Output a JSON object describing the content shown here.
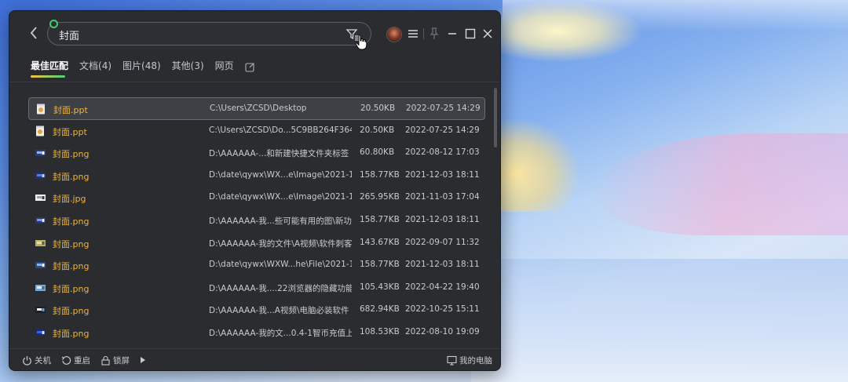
{
  "search": {
    "query": "封面"
  },
  "tabs": [
    {
      "label": "最佳匹配"
    },
    {
      "label": "文档(4)"
    },
    {
      "label": "图片(48)"
    },
    {
      "label": "其他(3)"
    },
    {
      "label": "网页"
    }
  ],
  "results": [
    {
      "icon": "ppt-file-icon",
      "name": "封面.ppt",
      "path": "C:\\Users\\ZCSD\\Desktop",
      "size": "20.50KB",
      "date": "2022-07-25 14:29",
      "selected": true
    },
    {
      "icon": "ppt-file-icon",
      "name": "封面.ppt",
      "path": "C:\\Users\\ZCSD\\Do...5C9BB264F36458D",
      "size": "20.50KB",
      "date": "2022-07-25 14:29"
    },
    {
      "icon": "image-thumbnail-icon",
      "name": "封面.png",
      "path": "D:\\AAAAAA-...和新建快捷文件夹标签",
      "size": "60.80KB",
      "date": "2022-08-12 17:03"
    },
    {
      "icon": "image-thumbnail-icon",
      "name": "封面.png",
      "path": "D:\\date\\qywx\\WX...e\\Image\\2021-12",
      "size": "158.77KB",
      "date": "2021-12-03 18:11"
    },
    {
      "icon": "image-thumbnail-icon",
      "name": "封面.jpg",
      "path": "D:\\date\\qywx\\WX...e\\Image\\2021-11",
      "size": "265.95KB",
      "date": "2021-11-03 17:04"
    },
    {
      "icon": "image-thumbnail-icon",
      "name": "封面.png",
      "path": "D:\\AAAAAA-我...些可能有用的图\\新功能",
      "size": "158.77KB",
      "date": "2021-12-03 18:11"
    },
    {
      "icon": "image-thumbnail-icon",
      "name": "封面.png",
      "path": "D:\\AAAAAA-我的文件\\A视频\\软件刺客",
      "size": "143.67KB",
      "date": "2022-09-07 11:32"
    },
    {
      "icon": "image-thumbnail-icon",
      "name": "封面.png",
      "path": "D:\\date\\qywx\\WXW...he\\File\\2021-12",
      "size": "158.77KB",
      "date": "2021-12-03 18:11"
    },
    {
      "icon": "image-thumbnail-icon",
      "name": "封面.png",
      "path": "D:\\AAAAAA-我....22浏览器的隐藏功能",
      "size": "105.43KB",
      "date": "2022-04-22 19:40"
    },
    {
      "icon": "image-thumbnail-icon",
      "name": "封面.png",
      "path": "D:\\AAAAAA-我...A视频\\电脑必装软件",
      "size": "682.94KB",
      "date": "2022-10-25 15:11"
    },
    {
      "icon": "image-thumbnail-icon",
      "name": "封面.png",
      "path": "D:\\AAAAAA-我的文...0.4-1智币充值上线",
      "size": "108.53KB",
      "date": "2022-08-10 19:09"
    }
  ],
  "bottom": {
    "shutdown": "关机",
    "restart": "重启",
    "lock": "锁屏",
    "my_computer": "我的电脑"
  }
}
